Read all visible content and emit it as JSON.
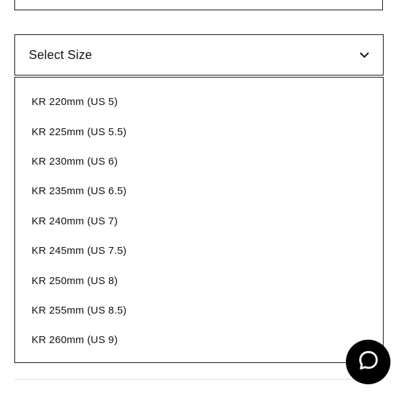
{
  "select": {
    "label": "Select Size",
    "icon": "chevron-down-icon"
  },
  "options": [
    "KR 220mm (US 5)",
    "KR 225mm (US 5.5)",
    "KR 230mm (US 6)",
    "KR 235mm (US 6.5)",
    "KR 240mm (US 7)",
    "KR 245mm (US 7.5)",
    "KR 250mm (US 8)",
    "KR 255mm (US 8.5)",
    "KR 260mm (US 9)"
  ],
  "chat": {
    "icon": "chat-bubble-icon",
    "color": "#000000"
  },
  "colors": {
    "border": "#111111",
    "divider": "#d9d9d9"
  }
}
